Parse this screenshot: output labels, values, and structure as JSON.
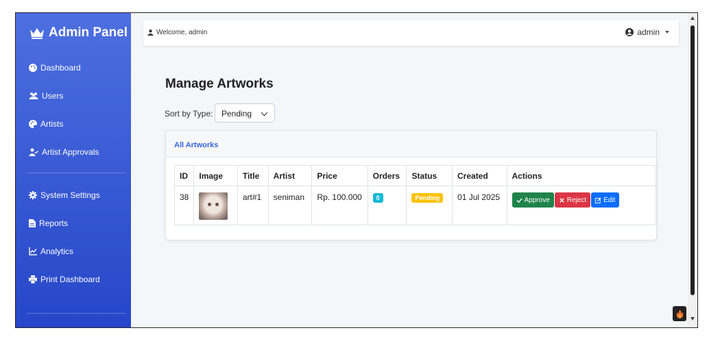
{
  "sidebar": {
    "brand": "Admin Panel",
    "items": [
      {
        "label": "Dashboard",
        "icon": "palette-icon"
      },
      {
        "label": "Users",
        "icon": "users-icon"
      },
      {
        "label": "Artists",
        "icon": "palette-icon"
      },
      {
        "label": "Artist Approvals",
        "icon": "user-check-icon"
      },
      {
        "label": "System Settings",
        "icon": "gear-icon"
      },
      {
        "label": "Reports",
        "icon": "document-icon"
      },
      {
        "label": "Analytics",
        "icon": "chart-line-icon"
      },
      {
        "label": "Print Dashboard",
        "icon": "printer-icon"
      }
    ]
  },
  "topbar": {
    "welcome": "Welcome, admin",
    "user": "admin"
  },
  "main": {
    "title": "Manage Artworks",
    "sort_label": "Sort by Type:",
    "sort_value": "Pending",
    "card_title": "All Artworks",
    "columns": [
      "ID",
      "Image",
      "Title",
      "Artist",
      "Price",
      "Orders",
      "Status",
      "Created",
      "Actions"
    ],
    "rows": [
      {
        "id": "38",
        "title": "art#1",
        "artist": "seniman",
        "price": "Rp. 100.000",
        "orders": "0",
        "status": "Pending",
        "created": "01 Jul 2025"
      }
    ],
    "actions": {
      "approve": "Approve",
      "reject": "Reject",
      "edit": "Edit"
    }
  },
  "colors": {
    "sidebar_top": "#4d6fe0",
    "sidebar_bottom": "#2646c9",
    "link": "#3566d8",
    "approve": "#1e8449",
    "reject": "#dc3545",
    "edit": "#0d6efd",
    "badge_info": "#17b8d8",
    "badge_warning": "#ffc107"
  }
}
